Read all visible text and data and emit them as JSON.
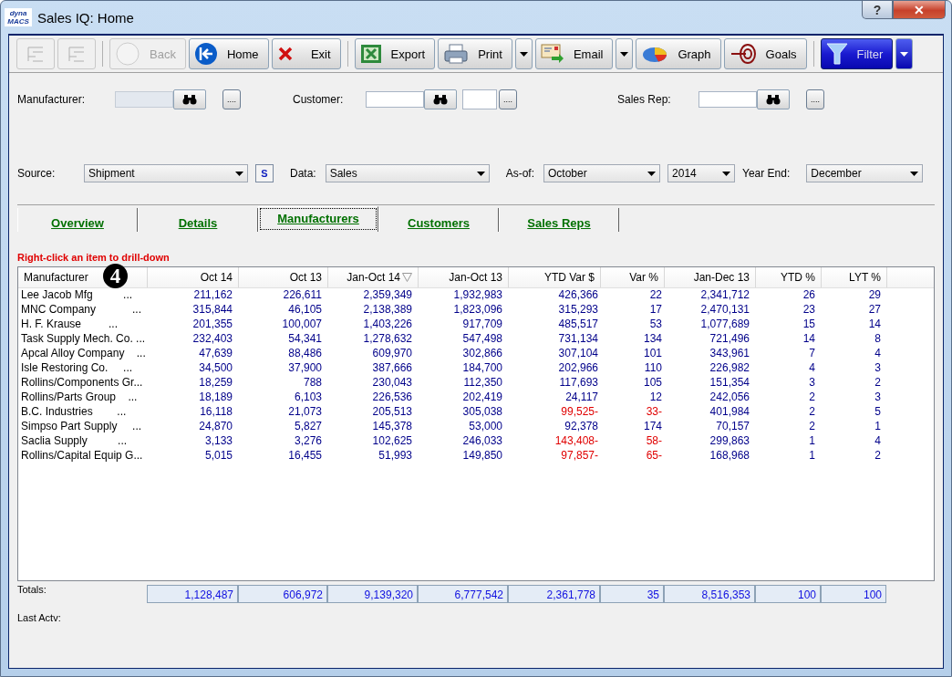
{
  "window": {
    "title": "Sales IQ: Home",
    "logo_top": "dyna",
    "logo_bottom": "MACS",
    "help": "?",
    "close": "✕"
  },
  "toolbar": [
    {
      "kind": "icon",
      "disabled": true
    },
    {
      "kind": "icon",
      "disabled": true
    },
    {
      "kind": "sep"
    },
    {
      "kind": "button",
      "label": "Back",
      "disabled": true
    },
    {
      "kind": "button",
      "label": "Home",
      "disabled": false
    },
    {
      "kind": "button",
      "label": "Exit",
      "disabled": false
    },
    {
      "kind": "sep"
    },
    {
      "kind": "button",
      "label": "Export",
      "disabled": false
    },
    {
      "kind": "button",
      "label": "Print",
      "disabled": false
    },
    {
      "kind": "drop"
    },
    {
      "kind": "button",
      "label": "Email",
      "disabled": false
    },
    {
      "kind": "drop"
    },
    {
      "kind": "button",
      "label": "Graph",
      "disabled": false
    },
    {
      "kind": "button",
      "label": "Goals",
      "disabled": false
    },
    {
      "kind": "sep"
    },
    {
      "kind": "primary",
      "label": "Filter"
    },
    {
      "kind": "primarydrop"
    }
  ],
  "lookups": [
    {
      "label": "Manufacturer:",
      "disabled": true,
      "extra_field": false,
      "more": "...."
    },
    {
      "label": "Customer:",
      "disabled": false,
      "extra_field": true,
      "more": "...."
    },
    {
      "label": "Sales Rep:",
      "disabled": false,
      "extra_field": false,
      "more": "...."
    }
  ],
  "selectors": [
    {
      "label": "Source:",
      "value": "Shipment",
      "button": "S"
    },
    {
      "label": "Data:",
      "value": "Sales"
    },
    {
      "label": "As-of:",
      "value": "October"
    },
    {
      "value": "2014"
    },
    {
      "label": "Year End:",
      "value": "December"
    }
  ],
  "tabs": [
    {
      "label": "Overview",
      "selected": false
    },
    {
      "label": "Details",
      "selected": false
    },
    {
      "label": "Manufacturers",
      "selected": true
    },
    {
      "label": "Customers",
      "selected": false
    },
    {
      "label": "Sales Reps",
      "selected": false
    }
  ],
  "hint": "Right-click an item to drill-down",
  "callout": "4",
  "table": {
    "columns": [
      {
        "label": "Manufacturer",
        "sorted": false
      },
      {
        "label": "Oct 14",
        "sorted": false
      },
      {
        "label": "Oct 13",
        "sorted": false
      },
      {
        "label": "Jan-Oct 14",
        "sorted": true
      },
      {
        "label": "Jan-Oct 13",
        "sorted": false
      },
      {
        "label": "YTD Var $",
        "sorted": false
      },
      {
        "label": "Var %",
        "sorted": false
      },
      {
        "label": "Jan-Dec 13",
        "sorted": false
      },
      {
        "label": "YTD %",
        "sorted": false
      },
      {
        "label": "LYT %",
        "sorted": false
      }
    ],
    "rows": [
      {
        "negative": false,
        "cells": [
          "Lee Jacob Mfg          ...",
          "211,162",
          "226,611",
          "2,359,349",
          "1,932,983",
          "426,366",
          "22",
          "2,341,712",
          "26",
          "29"
        ]
      },
      {
        "negative": false,
        "cells": [
          "MNC Company            ...",
          "315,844",
          "46,105",
          "2,138,389",
          "1,823,096",
          "315,293",
          "17",
          "2,470,131",
          "23",
          "27"
        ]
      },
      {
        "negative": false,
        "cells": [
          "H. F. Krause         ...",
          "201,355",
          "100,007",
          "1,403,226",
          "917,709",
          "485,517",
          "53",
          "1,077,689",
          "15",
          "14"
        ]
      },
      {
        "negative": false,
        "cells": [
          "Task Supply Mech. Co. ...",
          "232,403",
          "54,341",
          "1,278,632",
          "547,498",
          "731,134",
          "134",
          "721,496",
          "14",
          "8"
        ]
      },
      {
        "negative": false,
        "cells": [
          "Apcal Alloy Company    ...",
          "47,639",
          "88,486",
          "609,970",
          "302,866",
          "307,104",
          "101",
          "343,961",
          "7",
          "4"
        ]
      },
      {
        "negative": false,
        "cells": [
          "Isle Restoring Co.     ...",
          "34,500",
          "37,900",
          "387,666",
          "184,700",
          "202,966",
          "110",
          "226,982",
          "4",
          "3"
        ]
      },
      {
        "negative": false,
        "cells": [
          "Rollins/Components Gr...",
          "18,259",
          "788",
          "230,043",
          "112,350",
          "117,693",
          "105",
          "151,354",
          "3",
          "2"
        ]
      },
      {
        "negative": false,
        "cells": [
          "Rollins/Parts Group    ...",
          "18,189",
          "6,103",
          "226,536",
          "202,419",
          "24,117",
          "12",
          "242,056",
          "2",
          "3"
        ]
      },
      {
        "negative": true,
        "cells": [
          "B.C. Industries        ...",
          "16,118",
          "21,073",
          "205,513",
          "305,038",
          "99,525-",
          "33-",
          "401,984",
          "2",
          "5"
        ]
      },
      {
        "negative": false,
        "cells": [
          "Simpso Part Supply     ...",
          "24,870",
          "5,827",
          "145,378",
          "53,000",
          "92,378",
          "174",
          "70,157",
          "2",
          "1"
        ]
      },
      {
        "negative": true,
        "cells": [
          "Saclia Supply          ...",
          "3,133",
          "3,276",
          "102,625",
          "246,033",
          "143,408-",
          "58-",
          "299,863",
          "1",
          "4"
        ]
      },
      {
        "negative": true,
        "cells": [
          "Rollins/Capital Equip G...",
          "5,015",
          "16,455",
          "51,993",
          "149,850",
          "97,857-",
          "65-",
          "168,968",
          "1",
          "2"
        ]
      }
    ]
  },
  "totals": {
    "label": "Totals:",
    "values": [
      "1,128,487",
      "606,972",
      "9,139,320",
      "6,777,542",
      "2,361,778",
      "35",
      "8,516,353",
      "100",
      "100"
    ]
  },
  "last_activity": {
    "label": "Last Actv:"
  }
}
